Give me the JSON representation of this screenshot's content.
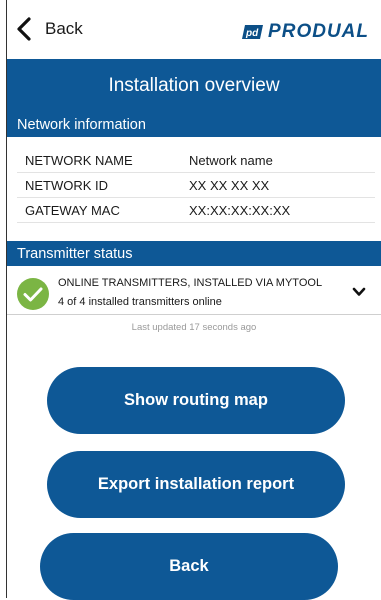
{
  "header": {
    "back_label": "Back",
    "logo_text": "PRODUAL",
    "title": "Installation overview"
  },
  "network": {
    "section_title": "Network information",
    "rows": [
      {
        "label": "NETWORK NAME",
        "value": "Network name"
      },
      {
        "label": "NETWORK ID",
        "value": "XX XX XX XX"
      },
      {
        "label": "GATEWAY MAC",
        "value": "XX:XX:XX:XX:XX"
      }
    ]
  },
  "transmitter": {
    "section_title": "Transmitter status",
    "status_title": "ONLINE TRANSMITTERS, INSTALLED VIA MYTOOL",
    "status_detail": "4 of 4 installed transmitters online",
    "last_updated": "Last updated 17 seconds ago"
  },
  "actions": {
    "routing_map": "Show routing map",
    "export_report": "Export installation report",
    "back": "Back"
  },
  "colors": {
    "primary": "#0e5896",
    "status_ok": "#7bb544"
  },
  "icons": {
    "back": "chevron-left-icon",
    "status": "check-circle-icon",
    "expand": "chevron-down-icon",
    "logo": "produal-logo-icon"
  }
}
